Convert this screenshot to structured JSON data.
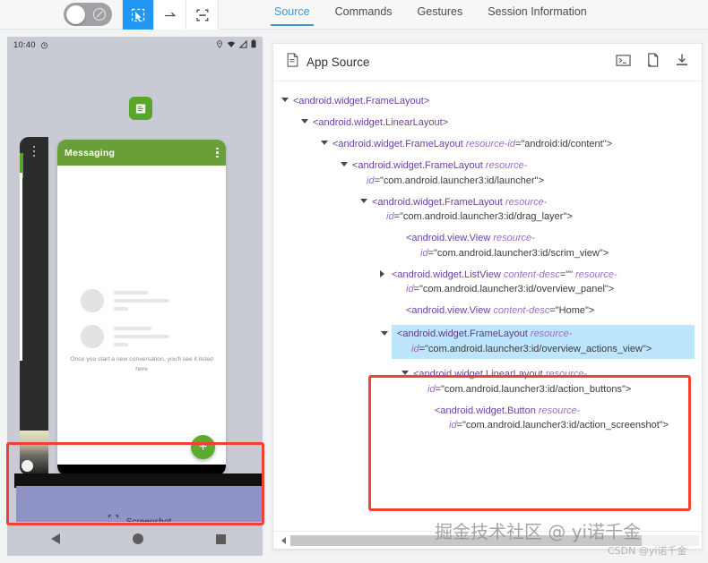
{
  "toolbar": {
    "toggle": {
      "name": "device-power-toggle",
      "state": "off"
    },
    "buttons": [
      {
        "icon": "select-element-icon",
        "label": "Select Element",
        "active": true
      },
      {
        "icon": "swipe-icon",
        "label": "Swipe By Coordinates",
        "active": false
      },
      {
        "icon": "tap-icon",
        "label": "Tap By Coordinates",
        "active": false
      }
    ]
  },
  "tabs": [
    {
      "label": "Source",
      "active": true
    },
    {
      "label": "Commands",
      "active": false
    },
    {
      "label": "Gestures",
      "active": false
    },
    {
      "label": "Session Information",
      "active": false
    }
  ],
  "device": {
    "statusbar": {
      "time": "10:40",
      "clock_icon": "alarm-icon",
      "icons": [
        "location-icon",
        "wifi-icon",
        "signal-icon",
        "battery-icon"
      ]
    },
    "app_icon": "messaging-app-icon",
    "card": {
      "title": "Messaging",
      "menu_icon": "overflow-menu-icon",
      "empty_text": "Once you start a new conversation, you'll see it listed here",
      "fab_label": "+"
    },
    "overview_actions": {
      "screenshot_label": "Screenshot",
      "screenshot_icon": "screenshot-icon",
      "highlight_color": "#9093c8"
    },
    "navbar": [
      "back-icon",
      "home-icon",
      "recents-icon"
    ]
  },
  "panel": {
    "title": "App Source",
    "title_icon": "file-icon",
    "actions": [
      {
        "icon": "console-icon",
        "label": "Open in Console"
      },
      {
        "icon": "copy-icon",
        "label": "Copy XML"
      },
      {
        "icon": "download-icon",
        "label": "Download XML"
      }
    ],
    "tree": [
      {
        "indent": 0,
        "caret": "expanded",
        "tag": "<android.widget.FrameLayout>",
        "selected": false
      },
      {
        "indent": 1,
        "caret": "expanded",
        "tag": "<android.widget.LinearLayout>",
        "selected": false
      },
      {
        "indent": 2,
        "caret": "expanded",
        "tag": "<android.widget.FrameLayout",
        "attr": "resource-id",
        "val": "=\"android:id/content\">",
        "selected": false
      },
      {
        "indent": 3,
        "caret": "expanded",
        "tag": "<android.widget.FrameLayout",
        "attr": "resource-",
        "attr2": "id",
        "val": "=\"com.android.launcher3:id/launcher\">",
        "wrap": true,
        "selected": false
      },
      {
        "indent": 4,
        "caret": "expanded",
        "tag": "<android.widget.FrameLayout",
        "attr": "resource-",
        "attr2": "id",
        "val": "=\"com.android.launcher3:id/drag_layer\">",
        "wrap": true,
        "selected": false
      },
      {
        "indent": 5,
        "caret": "none",
        "tag": "<android.view.View",
        "attr": "resource-",
        "attr2": "id",
        "val": "=\"com.android.launcher3:id/scrim_view\">",
        "wrap": true,
        "selected": false
      },
      {
        "indent": 5,
        "caret": "collapsed",
        "tag": "<android.widget.ListView",
        "attr": "content-desc",
        "val0": "=\"\" ",
        "attr3": "resource-",
        "attr2": "id",
        "val": "=\"com.android.launcher3:id/overview_panel\">",
        "wrap": true,
        "selected": false
      },
      {
        "indent": 5,
        "caret": "none",
        "tag": "<android.view.View",
        "attr": "content-desc",
        "val": "=\"Home\">",
        "selected": false
      },
      {
        "indent": 5,
        "caret": "expanded",
        "tag": "<android.widget.FrameLayout",
        "attr": "resource-",
        "attr2": "id",
        "val": "=\"com.android.launcher3:id/overview_actions_view\">",
        "wrap": true,
        "selected": true
      },
      {
        "indent": 6,
        "caret": "expanded",
        "tag": "<android.widget.LinearLayout",
        "attr": "resource-",
        "attr2": "id",
        "val": "=\"com.android.launcher3:id/action_buttons\">",
        "wrap": true,
        "selected": false
      },
      {
        "indent": 7,
        "caret": "none",
        "tag": "<android.widget.Button",
        "attr": "resource-",
        "attr2": "id",
        "val": "=\"com.android.launcher3:id/action_screenshot\">",
        "wrap": true,
        "selected": false
      }
    ],
    "scrollbar": {
      "arrow_icon": "scroll-left-arrow-icon"
    }
  },
  "watermark": {
    "main": "掘金技术社区 @ yi诺千金",
    "sub": "CSDN @yi诺千金"
  },
  "colors": {
    "accent": "#3d9ad1",
    "tool_active": "#2196f3",
    "annotation": "#ef4136",
    "selection": "#bde5fb",
    "app_green": "#689f38"
  }
}
